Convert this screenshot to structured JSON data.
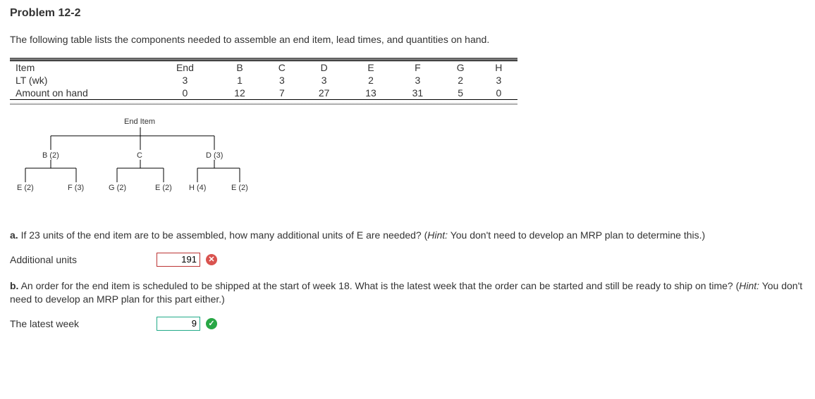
{
  "title": "Problem 12-2",
  "intro": "The following table lists the components needed to assemble an end item, lead times, and quantities on hand.",
  "table": {
    "rowLabels": [
      "Item",
      "LT (wk)",
      "Amount on hand"
    ],
    "cols": [
      "End",
      "B",
      "C",
      "D",
      "E",
      "F",
      "G",
      "H"
    ],
    "lt": [
      "3",
      "1",
      "3",
      "3",
      "2",
      "3",
      "2",
      "3"
    ],
    "amt": [
      "0",
      "12",
      "7",
      "27",
      "13",
      "31",
      "5",
      "0"
    ]
  },
  "tree": {
    "root": "End Item",
    "l1": [
      "B (2)",
      "C",
      "D (3)"
    ],
    "l2": [
      "E (2)",
      "F (3)",
      "G (2)",
      "E (2)",
      "H (4)",
      "E (2)"
    ]
  },
  "qa": {
    "prefix": "a.",
    "text": " If 23 units of the end item are to be assembled, how many additional units of E are needed? (",
    "hintLabel": "Hint:",
    "hint": " You don't need to develop an MRP plan to determine this.)",
    "answerLabel": "Additional units",
    "answerValue": "191",
    "correct": false
  },
  "qb": {
    "prefix": "b.",
    "text": " An order for the end item is scheduled to be shipped at the start of week 18. What is the latest week that the order can be started and still be ready to ship on time? (",
    "hintLabel": "Hint:",
    "hint": " You don't need to develop an MRP plan for this part either.)",
    "answerLabel": "The latest week",
    "answerValue": "9",
    "correct": true
  }
}
